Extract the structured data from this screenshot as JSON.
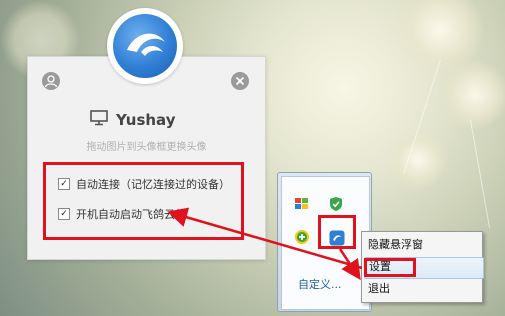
{
  "app": {
    "username": "Yushay",
    "avatar_hint": "拖动图片到头像框更换头像",
    "options": [
      {
        "label": "自动连接（记忆连接过的设备）",
        "checked": true
      },
      {
        "label": "开机自动启动飞鸽云传",
        "checked": true
      }
    ]
  },
  "tray": {
    "customize_label": "自定义..."
  },
  "context_menu": {
    "items": [
      {
        "label": "隐藏悬浮窗",
        "highlighted": false
      },
      {
        "label": "设置",
        "highlighted": true
      },
      {
        "label": "退出",
        "highlighted": false
      }
    ]
  },
  "icons": {
    "profile": "person-icon",
    "close": "close-icon",
    "monitor": "monitor-icon",
    "logo": "app-logo-icon"
  },
  "colors": {
    "annotation": "#e0121b",
    "accent_blue": "#2f7fd6"
  }
}
